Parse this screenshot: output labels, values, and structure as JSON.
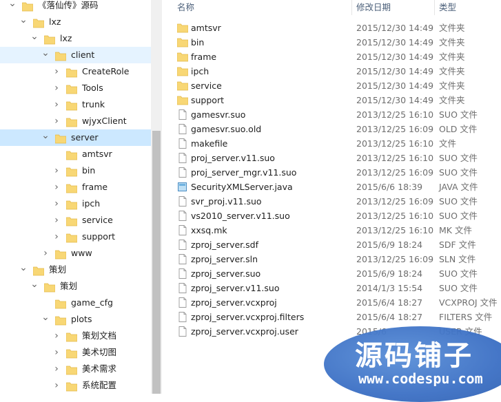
{
  "tree": {
    "items": [
      {
        "label": "《落仙传》源码",
        "expanded": true,
        "level": 0
      },
      {
        "label": "lxz",
        "expanded": true,
        "level": 1
      },
      {
        "label": "lxz",
        "expanded": true,
        "level": 2
      },
      {
        "label": "client",
        "expanded": true,
        "level": 3,
        "state": "hover"
      },
      {
        "label": "CreateRole",
        "expanded": false,
        "level": 4
      },
      {
        "label": "Tools",
        "expanded": false,
        "level": 4
      },
      {
        "label": "trunk",
        "expanded": false,
        "level": 4
      },
      {
        "label": "wjyxClient",
        "expanded": false,
        "level": 4
      },
      {
        "label": "server",
        "expanded": true,
        "level": 3,
        "state": "selected"
      },
      {
        "label": "amtsvr",
        "expanded": null,
        "level": 4
      },
      {
        "label": "bin",
        "expanded": false,
        "level": 4
      },
      {
        "label": "frame",
        "expanded": false,
        "level": 4
      },
      {
        "label": "ipch",
        "expanded": false,
        "level": 4
      },
      {
        "label": "service",
        "expanded": false,
        "level": 4
      },
      {
        "label": "support",
        "expanded": false,
        "level": 4
      },
      {
        "label": "www",
        "expanded": false,
        "level": 3
      },
      {
        "label": "策划",
        "expanded": true,
        "level": 1
      },
      {
        "label": "策划",
        "expanded": true,
        "level": 2
      },
      {
        "label": "game_cfg",
        "expanded": null,
        "level": 3
      },
      {
        "label": "plots",
        "expanded": true,
        "level": 3
      },
      {
        "label": "策划文档",
        "expanded": false,
        "level": 4
      },
      {
        "label": "美术切图",
        "expanded": false,
        "level": 4
      },
      {
        "label": "美术需求",
        "expanded": false,
        "level": 4
      },
      {
        "label": "系统配置",
        "expanded": false,
        "level": 4
      }
    ]
  },
  "columns": {
    "name": "名称",
    "date": "修改日期",
    "type": "类型"
  },
  "files": [
    {
      "name": "amtsvr",
      "date": "2015/12/30 14:49",
      "type": "文件夹",
      "icon": "folder"
    },
    {
      "name": "bin",
      "date": "2015/12/30 14:49",
      "type": "文件夹",
      "icon": "folder"
    },
    {
      "name": "frame",
      "date": "2015/12/30 14:49",
      "type": "文件夹",
      "icon": "folder"
    },
    {
      "name": "ipch",
      "date": "2015/12/30 14:49",
      "type": "文件夹",
      "icon": "folder"
    },
    {
      "name": "service",
      "date": "2015/12/30 14:49",
      "type": "文件夹",
      "icon": "folder"
    },
    {
      "name": "support",
      "date": "2015/12/30 14:49",
      "type": "文件夹",
      "icon": "folder"
    },
    {
      "name": "gamesvr.suo",
      "date": "2013/12/25 16:10",
      "type": "SUO 文件",
      "icon": "file"
    },
    {
      "name": "gamesvr.suo.old",
      "date": "2013/12/25 16:09",
      "type": "OLD 文件",
      "icon": "file"
    },
    {
      "name": "makefile",
      "date": "2013/12/25 16:10",
      "type": "文件",
      "icon": "file"
    },
    {
      "name": "proj_server.v11.suo",
      "date": "2013/12/25 16:10",
      "type": "SUO 文件",
      "icon": "file"
    },
    {
      "name": "proj_server_mgr.v11.suo",
      "date": "2013/12/25 16:09",
      "type": "SUO 文件",
      "icon": "file"
    },
    {
      "name": "SecurityXMLServer.java",
      "date": "2015/6/6 18:39",
      "type": "JAVA 文件",
      "icon": "java"
    },
    {
      "name": "svr_proj.v11.suo",
      "date": "2013/12/25 16:09",
      "type": "SUO 文件",
      "icon": "file"
    },
    {
      "name": "vs2010_server.v11.suo",
      "date": "2013/12/25 16:10",
      "type": "SUO 文件",
      "icon": "file"
    },
    {
      "name": "xxsq.mk",
      "date": "2013/12/25 16:10",
      "type": "MK 文件",
      "icon": "file"
    },
    {
      "name": "zproj_server.sdf",
      "date": "2015/6/9 18:24",
      "type": "SDF 文件",
      "icon": "file"
    },
    {
      "name": "zproj_server.sln",
      "date": "2013/12/25 16:09",
      "type": "SLN 文件",
      "icon": "file"
    },
    {
      "name": "zproj_server.suo",
      "date": "2015/6/9 18:24",
      "type": "SUO 文件",
      "icon": "file"
    },
    {
      "name": "zproj_server.v11.suo",
      "date": "2014/1/3 15:54",
      "type": "SUO 文件",
      "icon": "file"
    },
    {
      "name": "zproj_server.vcxproj",
      "date": "2015/6/4 18:27",
      "type": "VCXPROJ 文件",
      "icon": "file"
    },
    {
      "name": "zproj_server.vcxproj.filters",
      "date": "2015/6/4 18:27",
      "type": "FILTERS 文件",
      "icon": "file"
    },
    {
      "name": "zproj_server.vcxproj.user",
      "date": "2015/6",
      "type": "USER 文件",
      "icon": "file"
    }
  ],
  "watermark": {
    "title": "源码铺子",
    "url": "www.codespu.com"
  },
  "colors": {
    "folder": "#f8d775",
    "selected": "#cce8ff",
    "hover": "#e5f3ff",
    "watermark": "#3b6fc4"
  }
}
